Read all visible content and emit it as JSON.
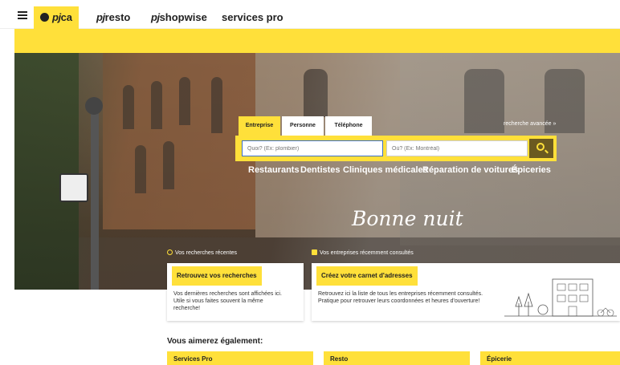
{
  "nav": {
    "tabs": [
      {
        "label": "pj",
        "suffix": "ca"
      },
      {
        "label": "pj",
        "suffix": "resto"
      },
      {
        "label": "pj",
        "suffix": "shopwise"
      },
      {
        "label": "",
        "suffix": "services pro"
      }
    ]
  },
  "search": {
    "tabs": [
      "Entreprise",
      "Personne",
      "Téléphone"
    ],
    "advanced": "recherche avancée »",
    "what_placeholder": "Quoi? (Ex: plombier)",
    "where_placeholder": "Où? (Ex: Montréal)"
  },
  "quicklinks": [
    "Restaurants",
    "Dentistes",
    "Cliniques médicales",
    "Réparation de voitures",
    "Épiceries"
  ],
  "greeting": "Bonne nuit",
  "recent": {
    "searches_label": "Vos recherches récentes",
    "businesses_label": "Vos entreprises récemment consultés",
    "card1_button": "Retrouvez vos recherches",
    "card1_desc_1": "Vos dernières recherches sont affichées ici.",
    "card1_desc_2": "Utile si vous faites souvent la même",
    "card1_desc_3": "recherche!",
    "card2_button": "Créez votre carnet d'adresses",
    "card2_desc_1": "Retrouvez ici la liste de tous les entreprises récemment consultés.",
    "card2_desc_2": "Pratique pour retrouver leurs coordonnées et heures d'ouverture!"
  },
  "also_like": {
    "title": "Vous aimerez également:",
    "items": [
      "Services Pro",
      "Resto",
      "Épicerie"
    ]
  },
  "colors": {
    "accent": "#ffe03a",
    "search_button": "#6b5a20"
  }
}
